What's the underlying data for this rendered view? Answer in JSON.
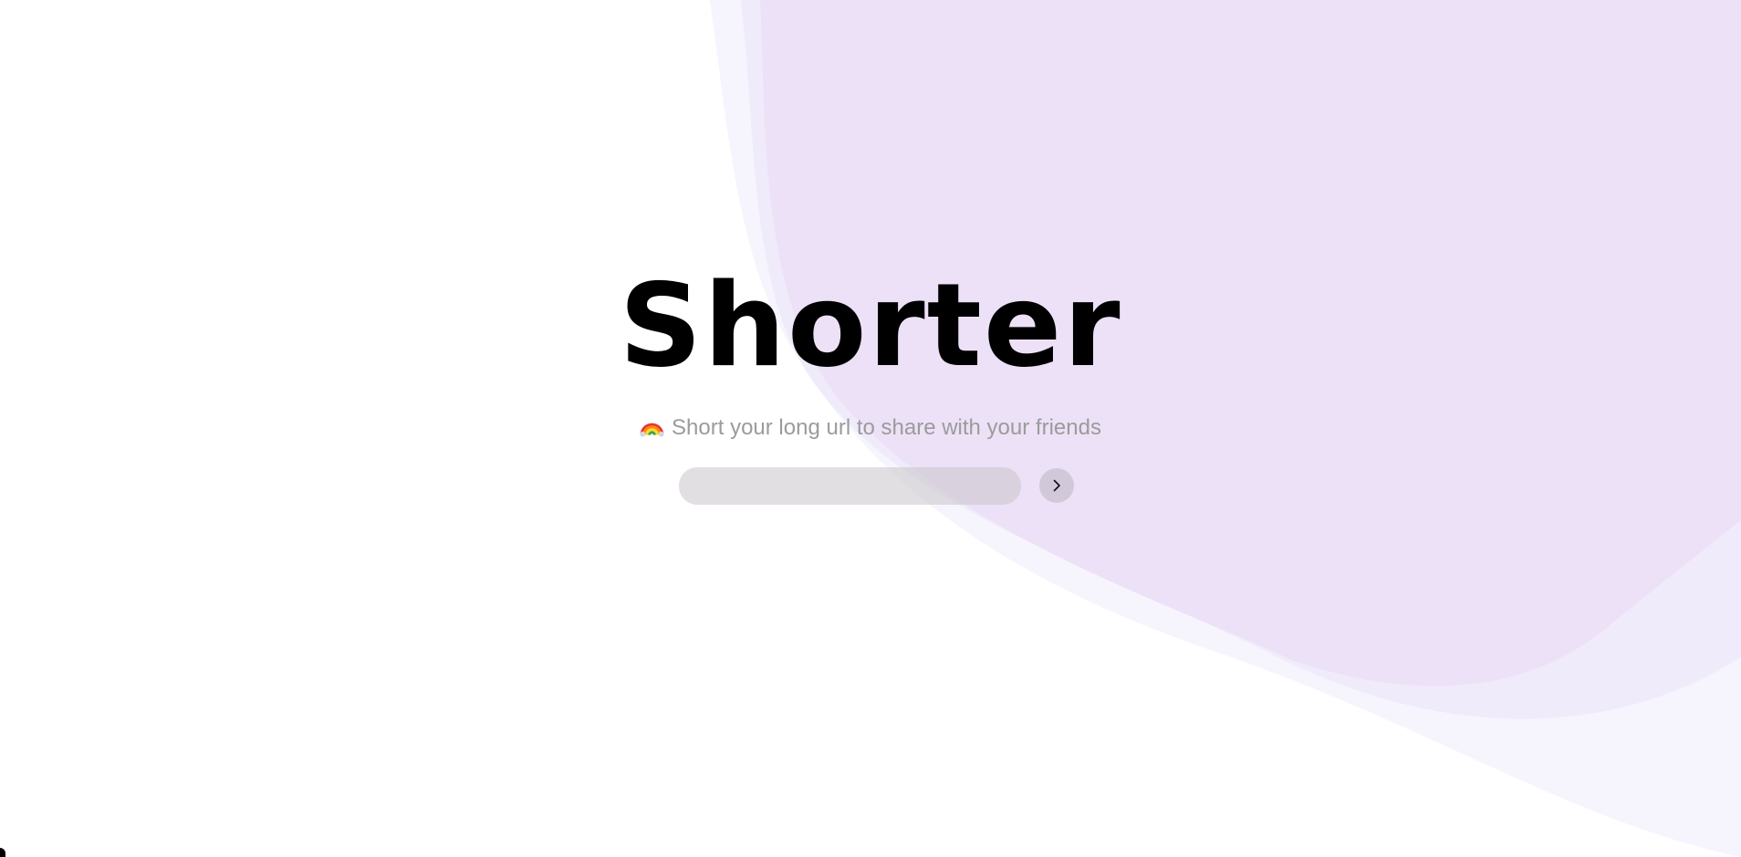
{
  "hero": {
    "title": "Shorter",
    "subtitle_emoji": "rainbow-icon",
    "subtitle": "Short your long url to share with your friends"
  },
  "form": {
    "url_input": {
      "value": "",
      "placeholder": ""
    },
    "submit_icon": "chevron-right-icon"
  },
  "colors": {
    "background": "#ffffff",
    "blob_back": "#f6f4fd",
    "blob_middle": "#f0ebfa",
    "blob_front": "#ede1f7",
    "title": "#000000",
    "subtitle": "#9b9b9b",
    "input_fill": "#e2e2e2",
    "button_fill": "#d6cfdd"
  }
}
